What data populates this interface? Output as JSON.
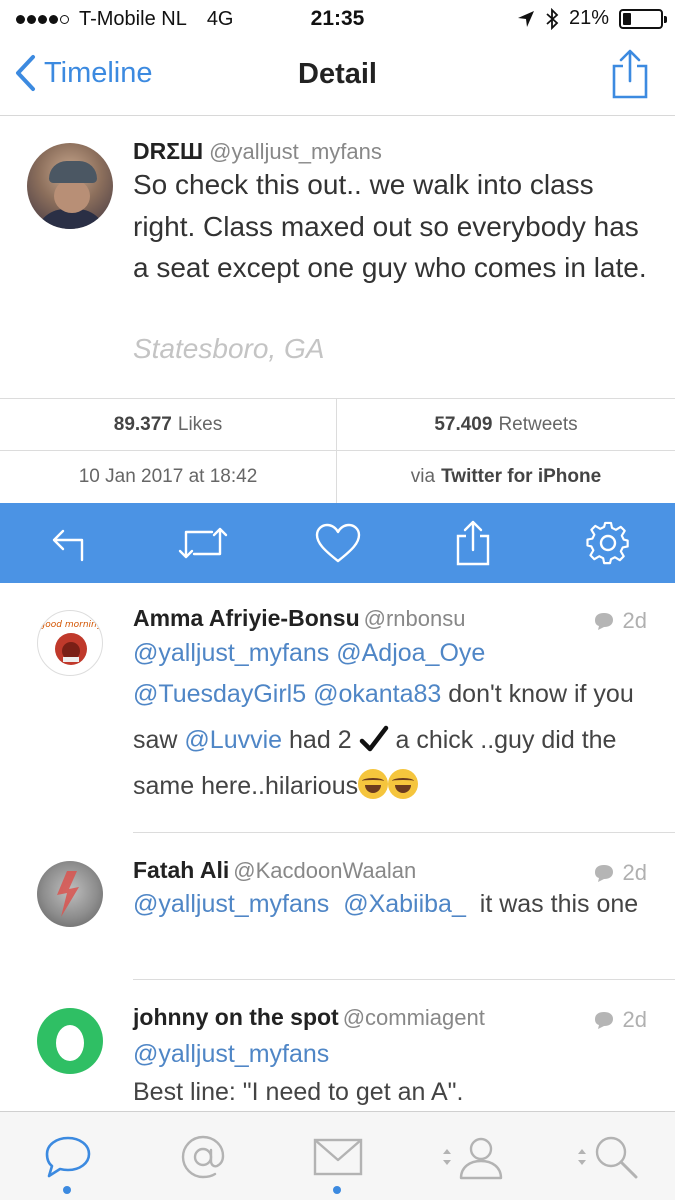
{
  "status_bar": {
    "carrier": "T-Mobile NL",
    "network": "4G",
    "time": "21:35",
    "battery": "21%",
    "battery_level": 0.21
  },
  "nav": {
    "back_label": "Timeline",
    "title": "Detail"
  },
  "tweet": {
    "name": "DRΣШ",
    "handle": "@yalljust_myfans",
    "text": "So check this out.. we walk into class right. Class maxed out so everybody has a seat except one guy who comes in late.",
    "location": "Statesboro, GA"
  },
  "stats": {
    "likes_value": "89.377",
    "likes_label": "Likes",
    "retweets_value": "57.409",
    "retweets_label": "Retweets",
    "date": "10 Jan 2017 at 18:42",
    "via_label": "via",
    "client": "Twitter for iPhone"
  },
  "actions": [
    "reply-icon",
    "retweet-icon",
    "like-icon",
    "share-icon",
    "settings-icon"
  ],
  "replies": [
    {
      "name": "Amma Afriyie-Bonsu",
      "handle": "@rnbonsu",
      "age": "2d",
      "avatar_text": "good morning",
      "m1": "@yalljust_myfans",
      "m2": "@Adjoa_Oye",
      "m3": "@TuesdayGirl5",
      "m4": "@okanta83",
      "t1": "don't know if you saw",
      "m5": "@Luvvie",
      "t2": "had 2",
      "t3": "a chick ..guy did the same here..hilarious"
    },
    {
      "name": "Fatah Ali",
      "handle": "@KacdoonWaalan",
      "age": "2d",
      "m1": "@yalljust_myfans",
      "m2": "@Xabiiba_",
      "t1": "it was this one"
    },
    {
      "name": "johnny on the spot",
      "handle": "@commiagent",
      "age": "2d",
      "m1": "@yalljust_myfans",
      "t1": "Best line:  \"I need to get an A\"."
    }
  ],
  "tabs": [
    "timeline-tab",
    "mentions-tab",
    "messages-tab",
    "profile-tab",
    "search-tab"
  ],
  "colors": {
    "accent": "#4b93e4",
    "link": "#4f86c6",
    "egg_green": "#2fbf64"
  }
}
